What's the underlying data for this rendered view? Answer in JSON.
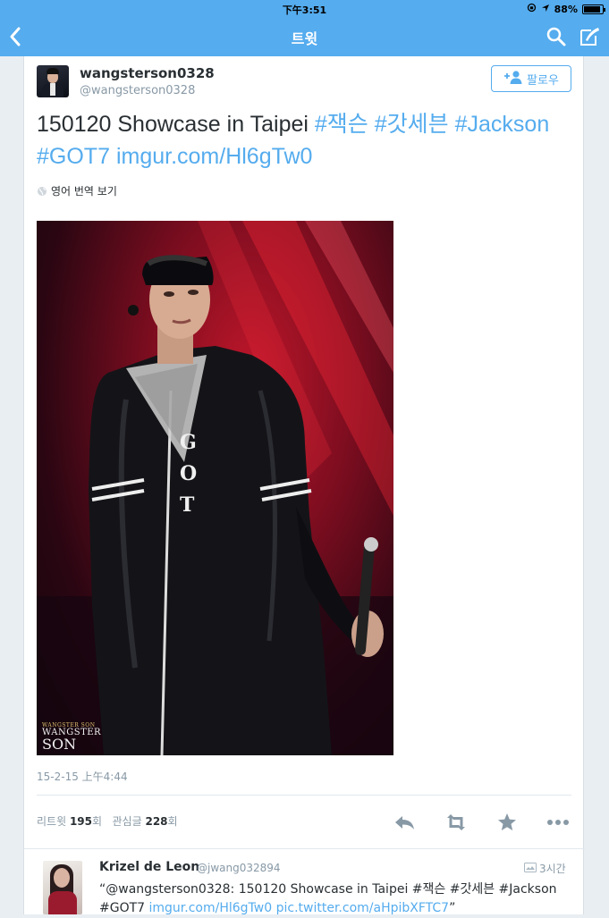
{
  "status_bar": {
    "time": "下午3:51",
    "battery": "88%",
    "battery_level": 0.88
  },
  "nav": {
    "title": "트윗",
    "icons": [
      "back-icon",
      "search-icon",
      "compose-icon"
    ]
  },
  "tweet": {
    "author_name": "wangsterson0328",
    "author_handle": "@wangsterson0328",
    "follow_label": "팔로우",
    "text_plain": "150120 Showcase in Taipei",
    "hashtags": [
      "#잭슨",
      "#갓세븐",
      "#Jackson",
      "#GOT7"
    ],
    "link": "imgur.com/Hl6gTw0",
    "translate_label": "영어 번역 보기",
    "photo_watermark": {
      "top": "WANGSTER SON",
      "line1": "WANGSTER",
      "line2": "SON"
    },
    "timestamp": "15-2-15 上午4:44",
    "retweets_label": "리트윗",
    "retweets_count": "195",
    "retweets_unit": "회",
    "favorites_label": "관심글",
    "favorites_count": "228",
    "favorites_unit": "회",
    "actions": [
      "reply-icon",
      "retweet-icon",
      "favorite-icon",
      "more-icon"
    ]
  },
  "reply": {
    "name": "Krizel de Leon",
    "handle": "@jwang032894",
    "time": "3시간",
    "text_prefix": "“@wangsterson0328: 150120 Showcase in Taipei #잭슨 #갓세븐 #Jackson #GOT7 ",
    "link1": "imgur.com/Hl6gTw0",
    "link2": "pic.twitter.com/aHpibXFTC7",
    "text_suffix": "”"
  },
  "colors": {
    "accent": "#55acee",
    "text": "#292f33",
    "muted": "#8899a6"
  }
}
